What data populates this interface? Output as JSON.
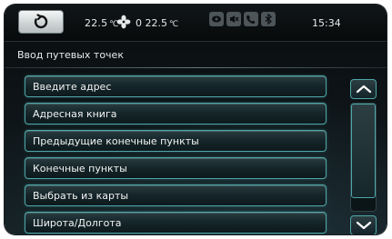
{
  "status_bar": {
    "temp_left": "22.5",
    "temp_unit": "℃",
    "fan_level": "0",
    "temp_right": "22.5",
    "icons": [
      "media-icon",
      "mute-icon",
      "phone-icon",
      "bluetooth-icon"
    ],
    "clock": "15:34"
  },
  "page": {
    "title": "Ввод путевых точек"
  },
  "menu": {
    "items": [
      {
        "label": "Введите адрес"
      },
      {
        "label": "Адресная книга"
      },
      {
        "label": "Предыдущие конечные пункты"
      },
      {
        "label": "Конечные пункты"
      },
      {
        "label": "Выбрать из карты"
      },
      {
        "label": "Широта/Долгота"
      }
    ]
  },
  "scroll": {
    "position": 0
  },
  "colors": {
    "accent": "#4fa6a8",
    "background": "#0d1316",
    "text": "#f2f4f4"
  }
}
